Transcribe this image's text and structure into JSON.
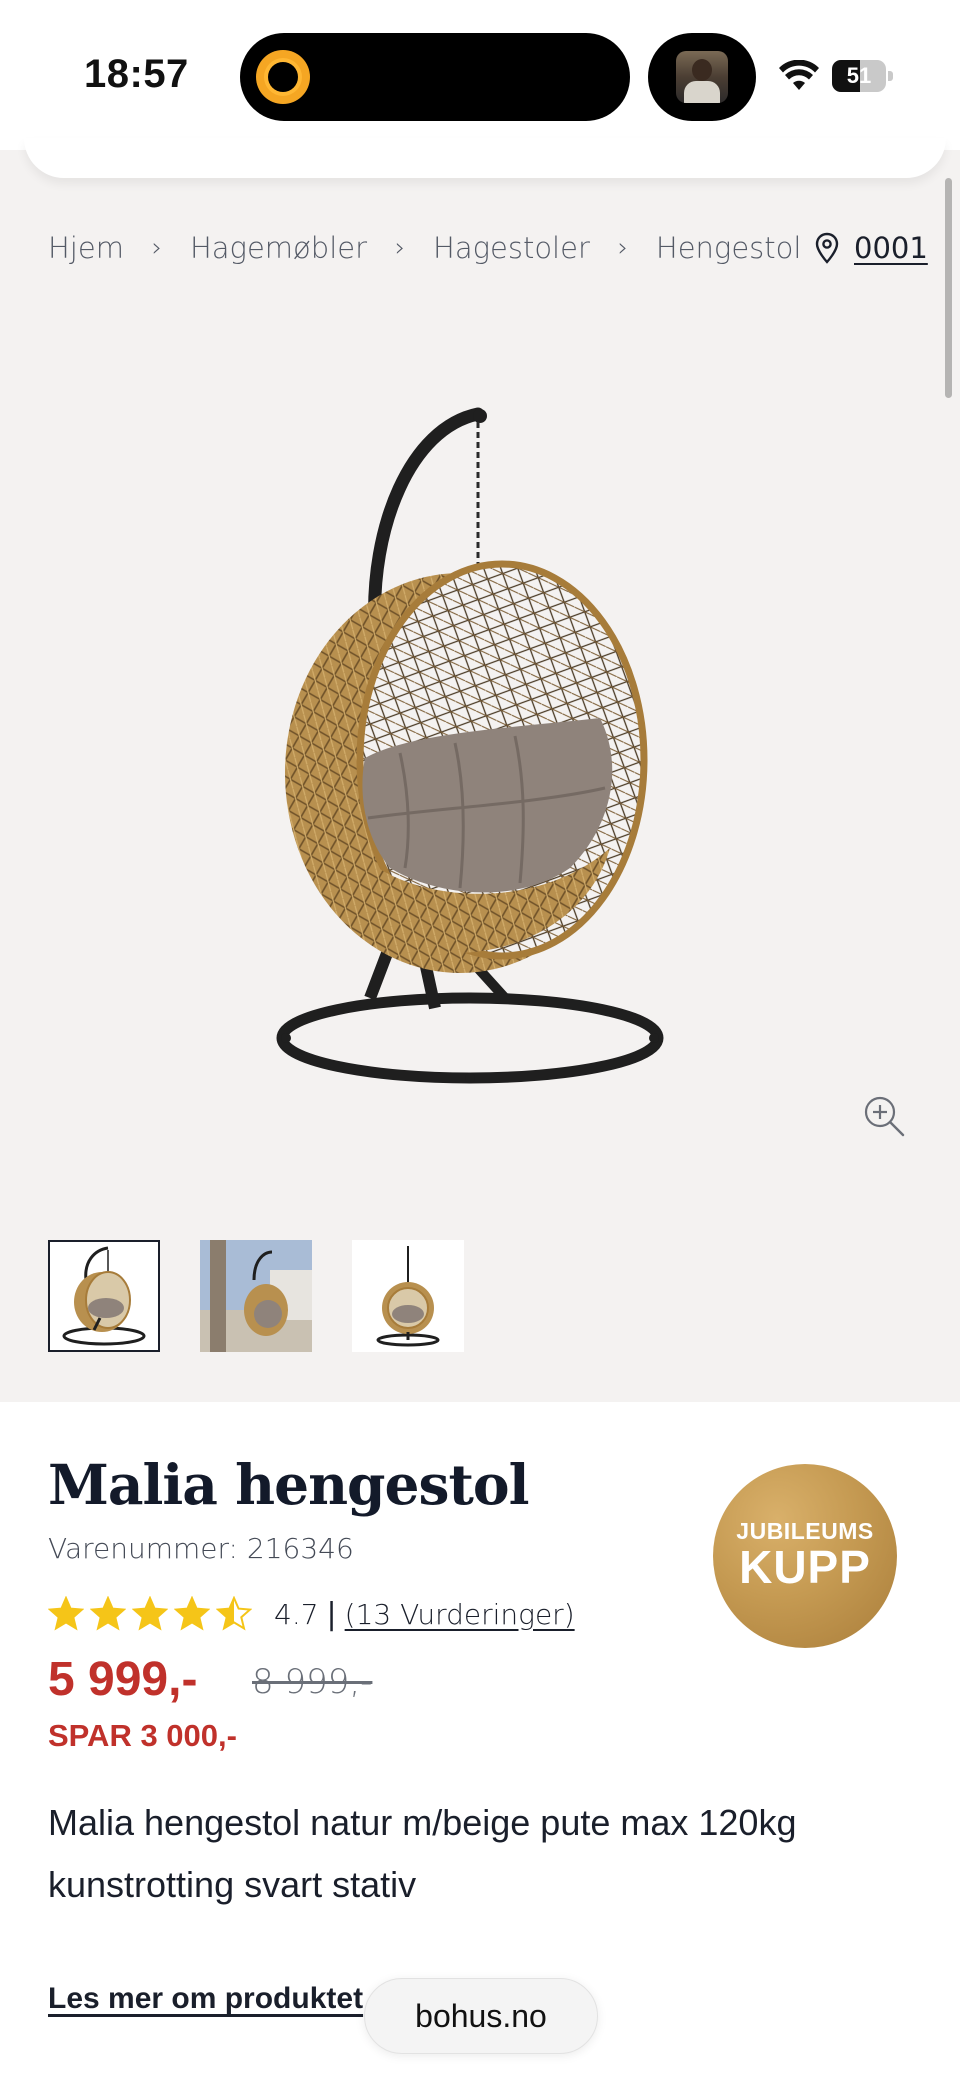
{
  "status_bar": {
    "time": "18:57",
    "battery_percent": "51",
    "battery_level": 0.51
  },
  "breadcrumb": {
    "items": [
      "Hjem",
      "Hagemøbler",
      "Hagestoler",
      "Hengestol"
    ],
    "separator": ">"
  },
  "store": {
    "label": "0001",
    "icon": "location-pin-icon"
  },
  "product": {
    "title": "Malia hengestol",
    "sku": "Varenummer: 216346",
    "rating_value": "4.7",
    "rating_stars": 4.5,
    "rating_separator": "|",
    "rating_count": "(13 Vurderinger)",
    "price": "5 999,-",
    "old_price": "8 999,-",
    "saving": "SPAR 3 000,-",
    "badge": {
      "top": "JUBILEUMS",
      "main": "KUPP"
    },
    "description": "Malia hengestol natur m/beige pute max 120kg kunstrotting svart stativ",
    "read_more": "Les mer om produktet"
  },
  "gallery": {
    "thumbnails": [
      "product-thumbnail",
      "lifestyle-photo-thumbnail",
      "product-thumbnail"
    ],
    "active_index": 0,
    "zoom_icon": "zoom-in-icon"
  },
  "browser": {
    "url": "bohus.no"
  },
  "colors": {
    "price_red": "#c0312b",
    "star_yellow": "#f5c518",
    "badge_gold": "#c59a52",
    "gallery_bg": "#f4f2f1"
  }
}
